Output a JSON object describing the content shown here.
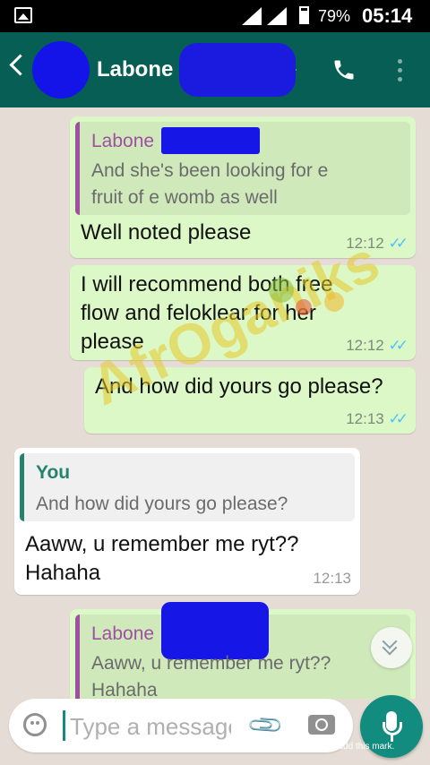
{
  "status_bar": {
    "battery": "79%",
    "time": "05:14"
  },
  "header": {
    "contact_name": "Labone"
  },
  "messages": [
    {
      "quote_sender": "Labone",
      "quote_lines": [
        "And she's been looking for e",
        "fruit of e womb as well"
      ],
      "text_lines": [
        "Well noted please"
      ],
      "time": "12:12",
      "ticks": "✓✓"
    },
    {
      "text_lines": [
        "I will recommend both free",
        "flow and feloklear for her",
        "please"
      ],
      "time": "12:12",
      "ticks": "✓✓"
    },
    {
      "text_lines": [
        "And how did yours go please?"
      ],
      "time": "12:13",
      "ticks": "✓✓"
    },
    {
      "quote_sender": "You",
      "quote_lines": [
        "And how did yours go please?"
      ],
      "text_lines": [
        "Aaww, u remember me ryt??",
        "Hahaha"
      ],
      "time": "12:13"
    },
    {
      "quote_sender": "Labone",
      "quote_lines": [
        "Aaww, u remember me ryt??",
        "Hahaha"
      ]
    }
  ],
  "watermark": {
    "text": "AfrOganiks"
  },
  "composer": {
    "placeholder": "Type a message"
  },
  "footer_note": "Processed using the free version of Watermarkly. The paid version does not add this mark.",
  "icons": {
    "status": [
      "gallery-icon",
      "signal-icon",
      "battery-icon"
    ],
    "header": [
      "back-arrow-icon",
      "video-call-icon",
      "phone-icon",
      "more-options-icon"
    ],
    "composer": [
      "emoji-icon",
      "attach-icon",
      "camera-icon",
      "mic-icon"
    ]
  },
  "colors": {
    "header": "#075e54",
    "outgoing_bubble": "#dcf8c6",
    "incoming_bubble": "#ffffff",
    "quote_bar_contact": "#a04fa3",
    "quote_bar_you": "#25826f",
    "read_ticks": "#4fc3f7",
    "redaction": "#1616e6"
  }
}
